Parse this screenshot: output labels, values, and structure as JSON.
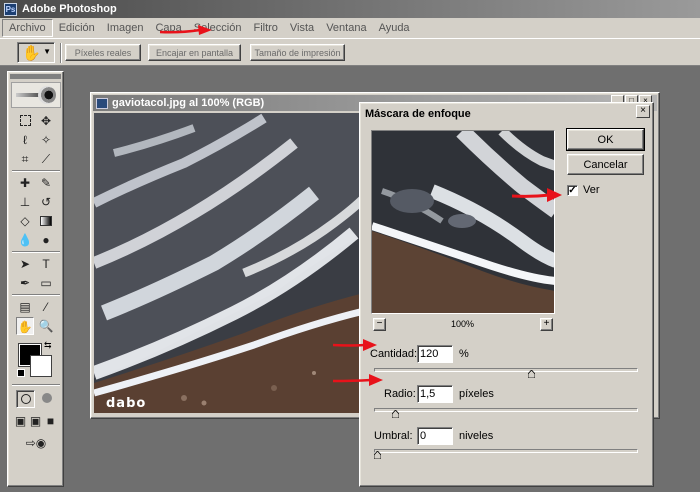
{
  "app": {
    "title": "Adobe Photoshop",
    "icon": "photoshop-logo"
  },
  "menubar": {
    "items": [
      {
        "label": "Archivo",
        "active": true
      },
      {
        "label": "Edición"
      },
      {
        "label": "Imagen"
      },
      {
        "label": "Capa"
      },
      {
        "label": "Selección"
      },
      {
        "label": "Filtro"
      },
      {
        "label": "Vista"
      },
      {
        "label": "Ventana"
      },
      {
        "label": "Ayuda"
      }
    ]
  },
  "options_bar": {
    "tool_icon": "hand-icon",
    "buttons": [
      "Píxeles reales",
      "Encajar en pantalla",
      "Tamaño de impresión"
    ]
  },
  "colors": {
    "foreground": "#000000",
    "background": "#ffffff",
    "annotation_arrow": "#e8121a"
  },
  "document": {
    "title": "gaviotacol.jpg al 100% (RGB)",
    "watermark": "dabo"
  },
  "dialog": {
    "title": "Máscara de enfoque",
    "ok_label": "OK",
    "cancel_label": "Cancelar",
    "preview_label": "Ver",
    "preview_checked": true,
    "zoom_out": "−",
    "zoom_in": "+",
    "zoom_level": "100%",
    "amount": {
      "label": "Cantidad:",
      "value": "120",
      "unit": "%",
      "slider": 0.6
    },
    "radius": {
      "label": "Radio:",
      "value": "1,5",
      "unit": "píxeles",
      "slider": 0.07
    },
    "threshold": {
      "label": "Umbral:",
      "value": "0",
      "unit": "niveles",
      "slider": 0.0
    }
  }
}
